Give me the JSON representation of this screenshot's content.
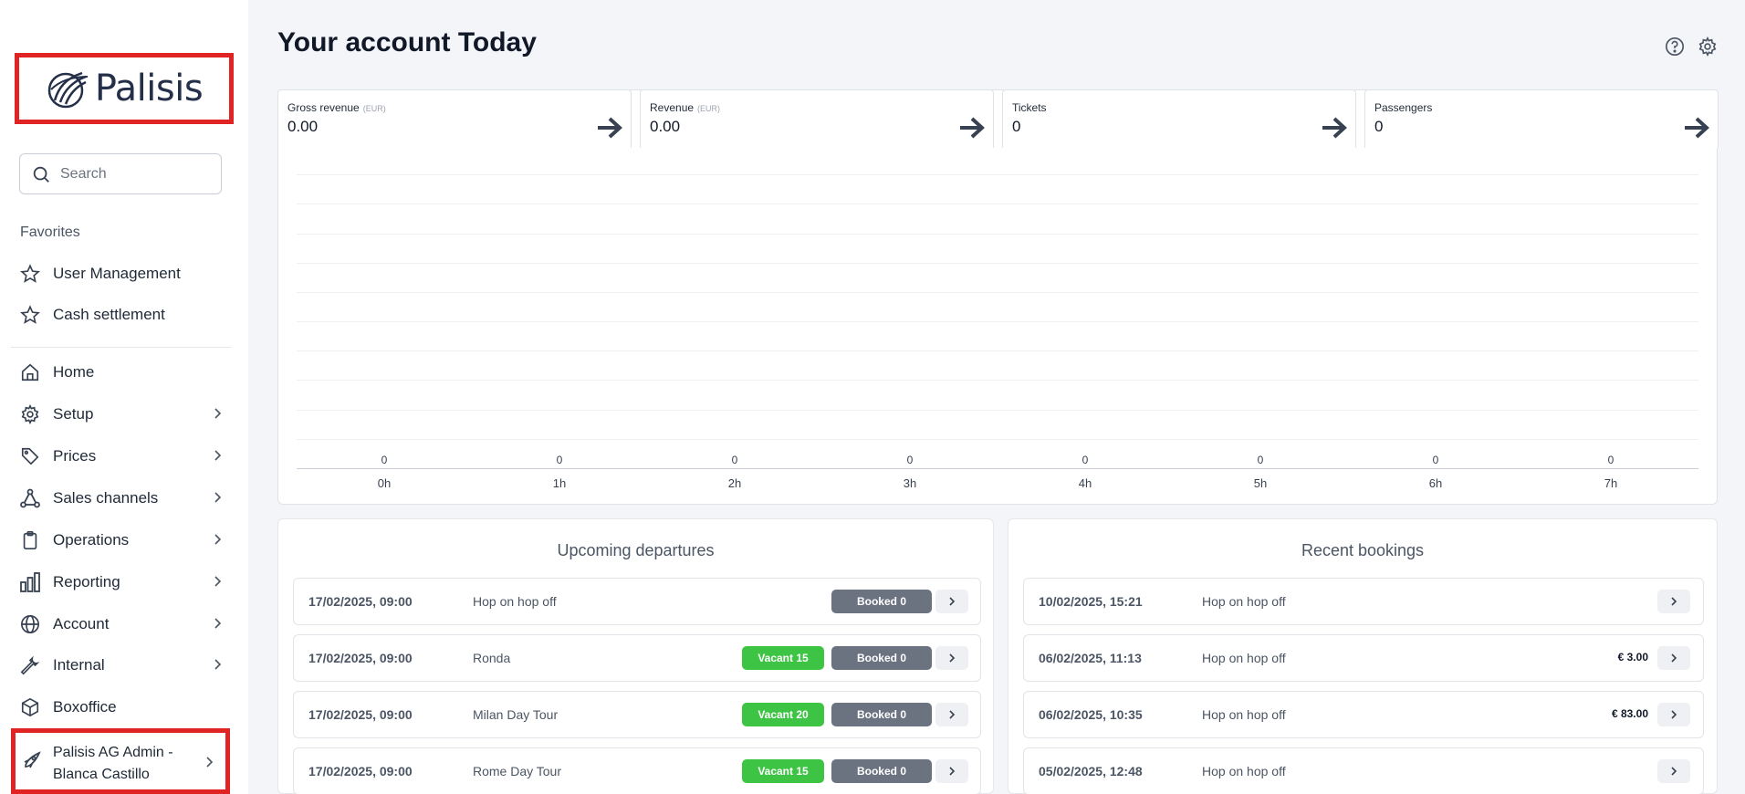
{
  "sidebar": {
    "logo_text": "Palisis",
    "search_placeholder": "Search",
    "favorites_title": "Favorites",
    "favorites": [
      {
        "label": "User Management",
        "icon": "star-icon"
      },
      {
        "label": "Cash settlement",
        "icon": "star-icon"
      }
    ],
    "nav": [
      {
        "label": "Home",
        "icon": "home-icon",
        "has_children": false
      },
      {
        "label": "Setup",
        "icon": "gear-icon",
        "has_children": true
      },
      {
        "label": "Prices",
        "icon": "tag-icon",
        "has_children": true
      },
      {
        "label": "Sales channels",
        "icon": "network-icon",
        "has_children": true
      },
      {
        "label": "Operations",
        "icon": "clipboard-icon",
        "has_children": true
      },
      {
        "label": "Reporting",
        "icon": "bar-chart-icon",
        "has_children": true
      },
      {
        "label": "Account",
        "icon": "globe-icon",
        "has_children": true
      },
      {
        "label": "Internal",
        "icon": "wrench-icon",
        "has_children": true
      },
      {
        "label": "Boxoffice",
        "icon": "box-icon",
        "has_children": false
      }
    ],
    "account_switcher": {
      "label": "Palisis AG Admin - Blanca Castillo",
      "icon": "rocket-icon"
    }
  },
  "header": {
    "title_prefix": "Your account",
    "title_emphasis": "Today",
    "icons": [
      "help-icon",
      "gear-icon"
    ]
  },
  "kpis": [
    {
      "label": "Gross revenue",
      "unit": "(EUR)",
      "value": "0.00"
    },
    {
      "label": "Revenue",
      "unit": "(EUR)",
      "value": "0.00"
    },
    {
      "label": "Tickets",
      "unit": "",
      "value": "0"
    },
    {
      "label": "Passengers",
      "unit": "",
      "value": "0"
    }
  ],
  "chart_data": {
    "type": "bar",
    "categories": [
      "0h",
      "1h",
      "2h",
      "3h",
      "4h",
      "5h",
      "6h",
      "7h"
    ],
    "values": [
      0,
      0,
      0,
      0,
      0,
      0,
      0,
      0
    ],
    "data_labels": [
      "0",
      "0",
      "0",
      "0",
      "0",
      "0",
      "0",
      "0"
    ],
    "title": "",
    "xlabel": "",
    "ylabel": "",
    "grid": true
  },
  "departures": {
    "title": "Upcoming departures",
    "rows": [
      {
        "date": "17/02/2025, 09:00",
        "name": "Hop on hop off",
        "vacant": "",
        "booked": "Booked 0"
      },
      {
        "date": "17/02/2025, 09:00",
        "name": "Ronda",
        "vacant": "Vacant 15",
        "booked": "Booked 0"
      },
      {
        "date": "17/02/2025, 09:00",
        "name": "Milan Day Tour",
        "vacant": "Vacant 20",
        "booked": "Booked 0"
      },
      {
        "date": "17/02/2025, 09:00",
        "name": "Rome Day Tour",
        "vacant": "Vacant 15",
        "booked": "Booked 0"
      }
    ]
  },
  "bookings": {
    "title": "Recent bookings",
    "rows": [
      {
        "date": "10/02/2025, 15:21",
        "name": "Hop on hop off",
        "price": ""
      },
      {
        "date": "06/02/2025, 11:13",
        "name": "Hop on hop off",
        "price": "€ 3.00"
      },
      {
        "date": "06/02/2025, 10:35",
        "name": "Hop on hop off",
        "price": "€ 83.00"
      },
      {
        "date": "05/02/2025, 12:48",
        "name": "Hop on hop off",
        "price": ""
      }
    ]
  },
  "colors": {
    "highlight_border": "#e02424",
    "vacant_badge": "#3ec444",
    "booked_badge": "#6b7280",
    "logo_navy": "#24304a"
  }
}
